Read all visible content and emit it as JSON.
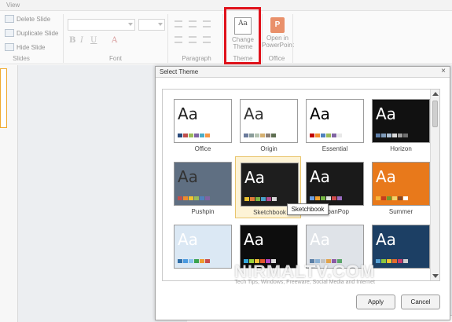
{
  "tabs": {
    "view": "View"
  },
  "ribbon": {
    "slides_group": {
      "delete": "Delete Slide",
      "duplicate": "Duplicate Slide",
      "hide": "Hide Slide",
      "label": "Slides"
    },
    "font_group": {
      "label": "Font"
    },
    "paragraph_group": {
      "label": "Paragraph"
    },
    "theme_group": {
      "change_theme": "Change Theme",
      "icon_text": "Aa",
      "label": "Theme"
    },
    "office_group": {
      "open_in_ppt": "Open in PowerPoint",
      "icon_text": "P",
      "label": "Office"
    }
  },
  "dialog": {
    "title": "Select Theme",
    "close": "×",
    "themes": [
      {
        "name": "Office",
        "bg": "#ffffff",
        "fg": "#222222",
        "swatches": [
          "#2a4b7c",
          "#c0504d",
          "#9bbb59",
          "#8064a2",
          "#4bacc6",
          "#f79646"
        ]
      },
      {
        "name": "Origin",
        "bg": "#ffffff",
        "fg": "#333333",
        "swatches": [
          "#6b7b9c",
          "#8a9c9a",
          "#b4c2b0",
          "#d5b070",
          "#8b7e74",
          "#5f6f52"
        ]
      },
      {
        "name": "Essential",
        "bg": "#ffffff",
        "fg": "#000000",
        "swatches": [
          "#c00000",
          "#f28f2e",
          "#4f81bd",
          "#9bbb59",
          "#8064a2",
          "#e8e8e8"
        ]
      },
      {
        "name": "Horizon",
        "bg": "#111111",
        "fg": "#ffffff",
        "swatches": [
          "#5e7ea8",
          "#7f9bb9",
          "#aec0d3",
          "#d9d9d9",
          "#a0a0a0",
          "#707070"
        ]
      },
      {
        "name": "Pushpin",
        "bg": "#5f6f82",
        "fg": "#333333",
        "swatches": [
          "#c0504d",
          "#ef8a2c",
          "#f3c32c",
          "#9bbb59",
          "#4f81bd",
          "#8064a2"
        ]
      },
      {
        "name": "Sketchbook",
        "bg": "#1e1e1e",
        "fg": "#ffffff",
        "swatches": [
          "#e9c030",
          "#e07b39",
          "#7fb241",
          "#4aa0c9",
          "#b34c8f",
          "#d5d5d5"
        ]
      },
      {
        "name": "UrbanPop",
        "bg": "#1a1a1a",
        "fg": "#ffffff",
        "swatches": [
          "#6a9de0",
          "#f0a030",
          "#78b845",
          "#e0e0e0",
          "#d04c4c",
          "#9a6bc0"
        ]
      },
      {
        "name": "Summer",
        "bg": "#e8791b",
        "fg": "#ffffff",
        "swatches": [
          "#f5b43a",
          "#c63c1e",
          "#6f9a2c",
          "#f2d46b",
          "#8a4a24",
          "#ffffff"
        ]
      },
      {
        "name": "",
        "bg": "#dbe8f4",
        "fg": "#ffffff",
        "swatches": [
          "#2e6ea8",
          "#4b9adf",
          "#8bc2ee",
          "#3aa34f",
          "#ef9b2e",
          "#c94c4c"
        ]
      },
      {
        "name": "",
        "bg": "#0d0d0d",
        "fg": "#ffffff",
        "swatches": [
          "#34a6d8",
          "#9bd23c",
          "#f5c23a",
          "#e0562a",
          "#b146c2",
          "#dadada"
        ]
      },
      {
        "name": "",
        "bg": "#dfe3e8",
        "fg": "#ffffff",
        "swatches": [
          "#5b7fa6",
          "#8bb1d4",
          "#c3c3c3",
          "#e1a34b",
          "#8c5aa5",
          "#5aa56a"
        ]
      },
      {
        "name": "",
        "bg": "#1c3f64",
        "fg": "#ffffff",
        "swatches": [
          "#56a0d3",
          "#8cc63e",
          "#f2c12e",
          "#e46b2c",
          "#c93a6a",
          "#d0d0d0"
        ]
      }
    ],
    "tooltip": "Sketchbook",
    "apply": "Apply",
    "cancel": "Cancel"
  },
  "watermark": {
    "brand": "NIRMALTV.COM",
    "tagline": "Tech Tips, Windows, Freeware, Social Media and Internet"
  }
}
